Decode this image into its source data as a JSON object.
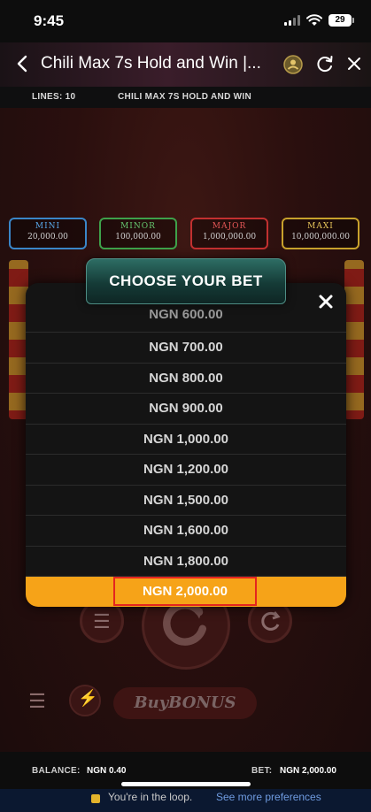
{
  "status_bar": {
    "time": "9:45",
    "battery": "29"
  },
  "browser": {
    "title": "Chili Max 7s Hold and Win |..."
  },
  "game_info": {
    "lines": "LINES: 10",
    "name": "CHILI MAX 7S HOLD AND WIN"
  },
  "jackpots": [
    {
      "name": "MINI",
      "value": "20,000.00"
    },
    {
      "name": "MINOR",
      "value": "100,000.00"
    },
    {
      "name": "MAJOR",
      "value": "1,000,000.00"
    },
    {
      "name": "MAXI",
      "value": "10,000,000.00"
    }
  ],
  "modal": {
    "title": "CHOOSE YOUR BET",
    "options": [
      "NGN 600.00",
      "NGN 700.00",
      "NGN 800.00",
      "NGN 900.00",
      "NGN 1,000.00",
      "NGN 1,200.00",
      "NGN 1,500.00",
      "NGN 1,600.00",
      "NGN 1,800.00"
    ],
    "selected": "NGN 2,000.00"
  },
  "buy_bonus": {
    "label": "BuyBONUS"
  },
  "footer": {
    "balance_label": "BALANCE:",
    "balance_value": "NGN 0.40",
    "bet_label": "BET:",
    "bet_value": "NGN 2,000.00"
  },
  "banner": {
    "text": "You're in the loop.",
    "link": "See more preferences"
  },
  "colors": {
    "accent": "#f6a318",
    "selected_border": "#e4251f",
    "modal_bg": "#141414",
    "header_teal": "#1d4d47"
  }
}
